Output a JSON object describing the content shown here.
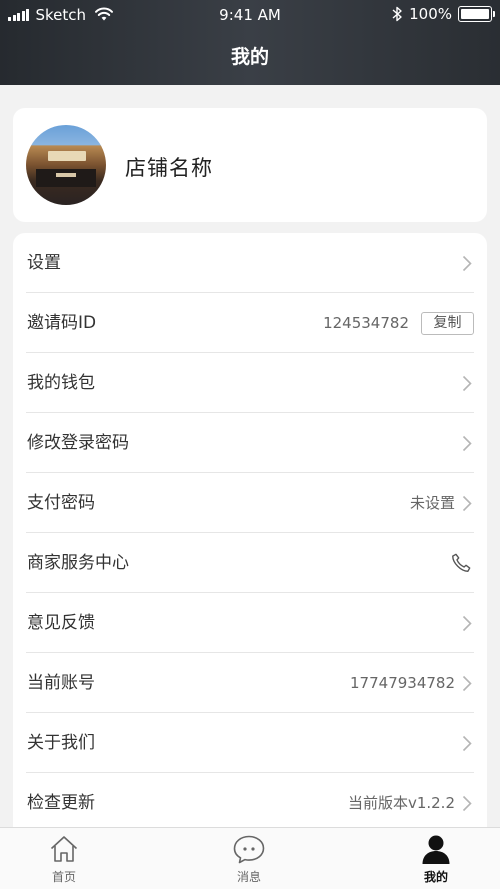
{
  "status_bar": {
    "carrier": "Sketch",
    "time": "9:41 AM",
    "battery": "100%",
    "battery_level": 1.0
  },
  "header": {
    "title": "我的"
  },
  "profile": {
    "shop_name": "店铺名称"
  },
  "menu": {
    "items": [
      {
        "label": "设置",
        "value": ""
      },
      {
        "label": "邀请码ID",
        "value": "124534782",
        "action": "复制"
      },
      {
        "label": "我的钱包",
        "value": ""
      },
      {
        "label": "修改登录密码",
        "value": ""
      },
      {
        "label": "支付密码",
        "value": "未设置"
      },
      {
        "label": "商家服务中心",
        "value": ""
      },
      {
        "label": "意见反馈",
        "value": ""
      },
      {
        "label": "当前账号",
        "value": "17747934782"
      },
      {
        "label": "关于我们",
        "value": ""
      },
      {
        "label": "检查更新",
        "value": "当前版本v1.2.2"
      }
    ]
  },
  "tabbar": {
    "tabs": [
      {
        "label": "首页",
        "icon": "home-icon",
        "active": false
      },
      {
        "label": "消息",
        "icon": "message-icon",
        "active": false
      },
      {
        "label": "我的",
        "icon": "user-icon",
        "active": true
      }
    ]
  },
  "colors": {
    "header_bg": "#2f3338",
    "page_bg": "#f2f2f2",
    "card_bg": "#ffffff",
    "active_tab": "#111111"
  }
}
